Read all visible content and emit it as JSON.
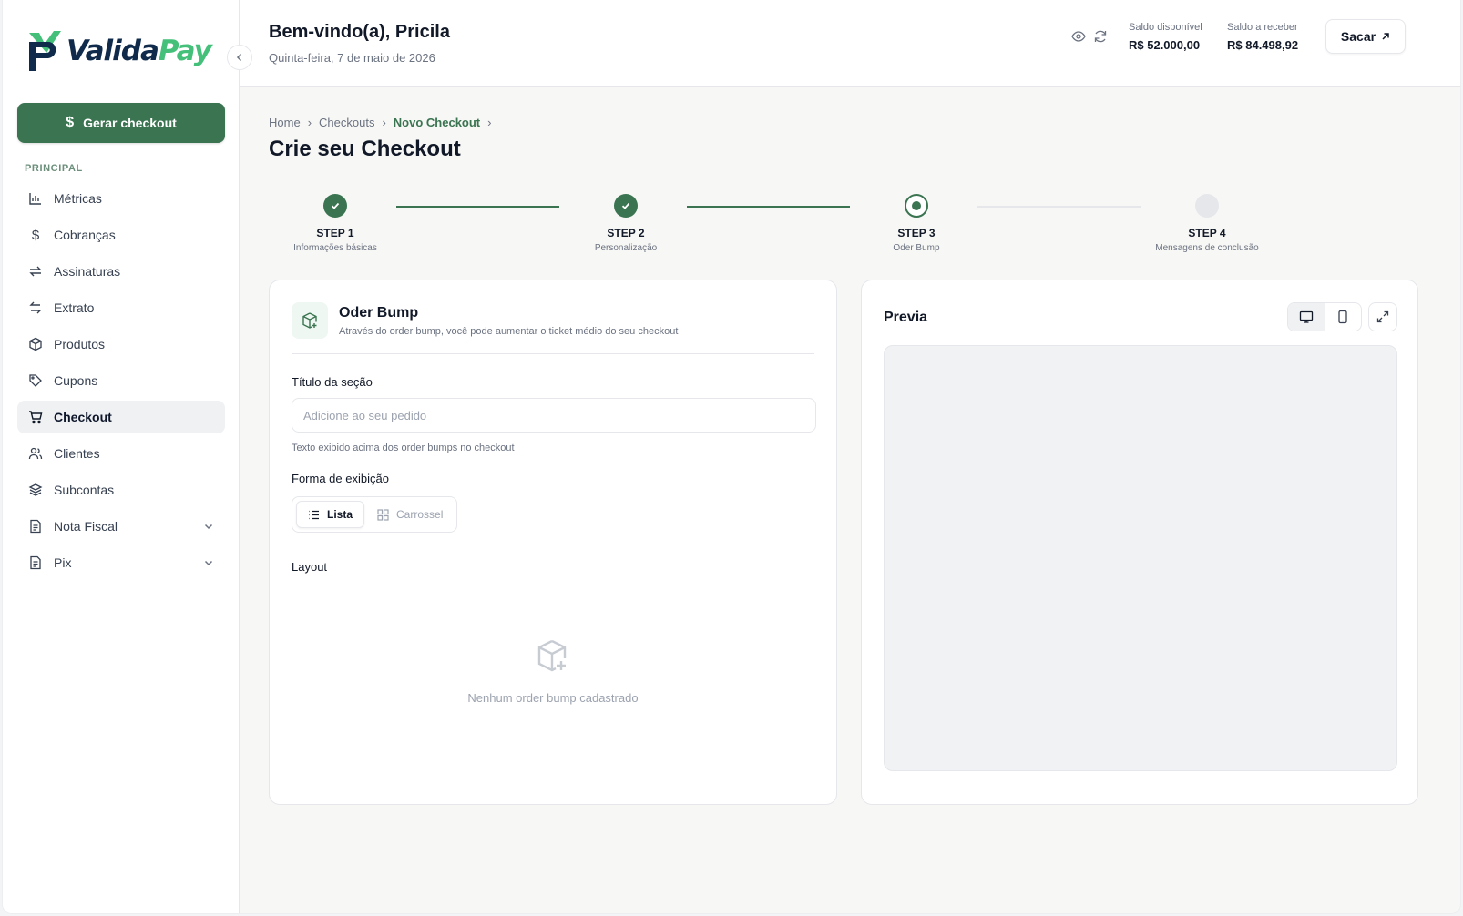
{
  "brand": {
    "name_a": "Valida",
    "name_b": "Pay",
    "accent": "#3a7451",
    "logo_green": "#45c07a",
    "logo_navy": "#0f2a4a"
  },
  "sidebar": {
    "generate_label": "Gerar checkout",
    "section": "PRINCIPAL",
    "items": [
      {
        "label": "Métricas",
        "icon": "bar-chart-icon"
      },
      {
        "label": "Cobranças",
        "icon": "dollar-icon"
      },
      {
        "label": "Assinaturas",
        "icon": "repeat-icon"
      },
      {
        "label": "Extrato",
        "icon": "transfer-icon"
      },
      {
        "label": "Produtos",
        "icon": "box-icon"
      },
      {
        "label": "Cupons",
        "icon": "tag-icon"
      },
      {
        "label": "Checkout",
        "icon": "cart-icon",
        "active": true
      },
      {
        "label": "Clientes",
        "icon": "users-icon"
      },
      {
        "label": "Subcontas",
        "icon": "layers-icon"
      },
      {
        "label": "Nota Fiscal",
        "icon": "document-icon",
        "expandable": true
      },
      {
        "label": "Pix",
        "icon": "document-icon",
        "expandable": true
      }
    ]
  },
  "header": {
    "welcome": "Bem-vindo(a), Pricila",
    "date": "Quinta-feira, 7 de maio de 2026",
    "balance_available_label": "Saldo disponível",
    "balance_available": "R$ 52.000,00",
    "balance_receivable_label": "Saldo a receber",
    "balance_receivable": "R$ 84.498,92",
    "withdraw_label": "Sacar"
  },
  "breadcrumb": [
    "Home",
    "Checkouts",
    "Novo Checkout"
  ],
  "page_title": "Crie seu Checkout",
  "steps": [
    {
      "label": "STEP 1",
      "desc": "Informações básicas",
      "state": "done"
    },
    {
      "label": "STEP 2",
      "desc": "Personalização",
      "state": "done"
    },
    {
      "label": "STEP 3",
      "desc": "Oder Bump",
      "state": "current"
    },
    {
      "label": "STEP 4",
      "desc": "Mensagens de conclusão",
      "state": "todo"
    }
  ],
  "order_bump": {
    "title": "Oder Bump",
    "subtitle": "Através do order bump, você pode aumentar o ticket médio do seu checkout",
    "section_title_label": "Título da seção",
    "section_title_placeholder": "Adicione ao seu pedido",
    "section_title_value": "",
    "section_title_hint": "Texto exibido acima dos order bumps no checkout",
    "display_label": "Forma de exibição",
    "display_options": [
      "Lista",
      "Carrossel"
    ],
    "display_selected": "Lista",
    "layout_label": "Layout",
    "empty_text": "Nenhum order bump cadastrado"
  },
  "preview": {
    "title": "Previa",
    "mode": "desktop"
  }
}
